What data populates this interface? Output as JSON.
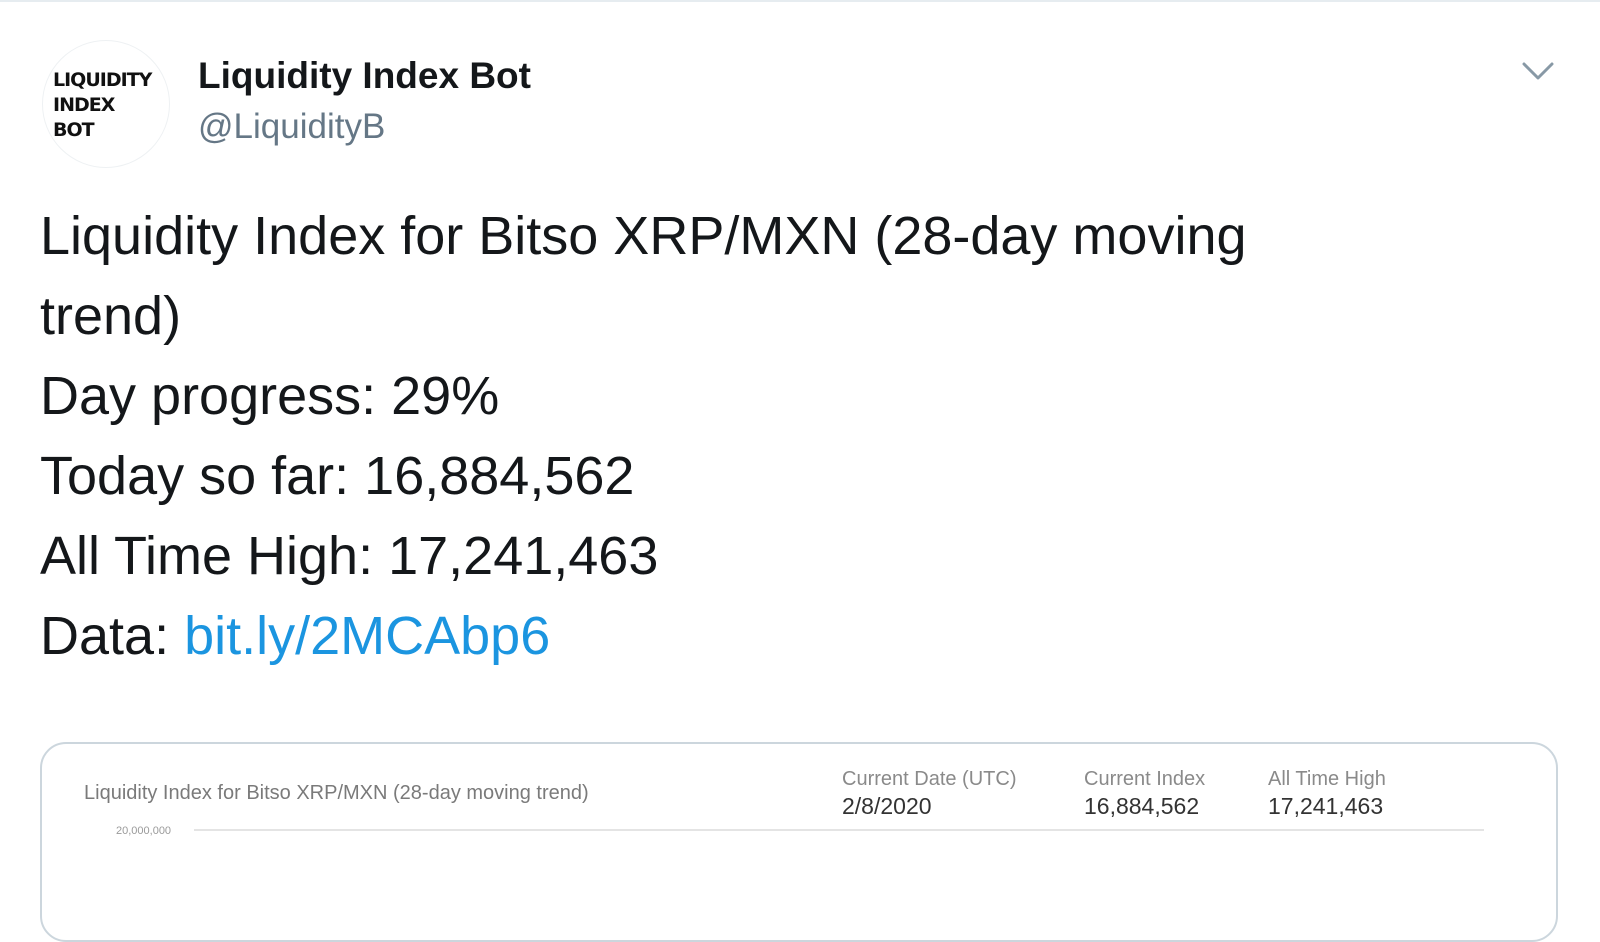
{
  "tweet": {
    "avatar": {
      "logo_text": "LIQUIDITY\nINDEX\nBOT"
    },
    "author": {
      "display_name": "Liquidity Index Bot",
      "handle": "@LiquidityB"
    },
    "menu_icon": "chevron-down-icon",
    "body": {
      "line1": "Liquidity Index for Bitso XRP/MXN (28-day moving",
      "line2": "trend)",
      "day_progress": "Day progress: 29%",
      "today_so_far": "Today so far: 16,884,562",
      "all_time_high": "All Time High: 17,241,463",
      "data_label": "Data: ",
      "data_link": "bit.ly/2MCAbp6"
    },
    "card": {
      "title": "Liquidity Index for Bitso XRP/MXN (28-day moving trend)",
      "stats": [
        {
          "label": "Current Date (UTC)",
          "value": "2/8/2020"
        },
        {
          "label": "Current Index",
          "value": "16,884,562"
        },
        {
          "label": "All Time High",
          "value": "17,241,463"
        }
      ]
    }
  },
  "chart_data": {
    "type": "line",
    "title": "Liquidity Index for Bitso XRP/MXN (28-day moving trend)",
    "y_tick_labels": [
      "20,000,000"
    ],
    "grid": true
  },
  "colors": {
    "link": "#1b95e0",
    "secondary_text": "#657786",
    "border": "#ccd6dd"
  }
}
